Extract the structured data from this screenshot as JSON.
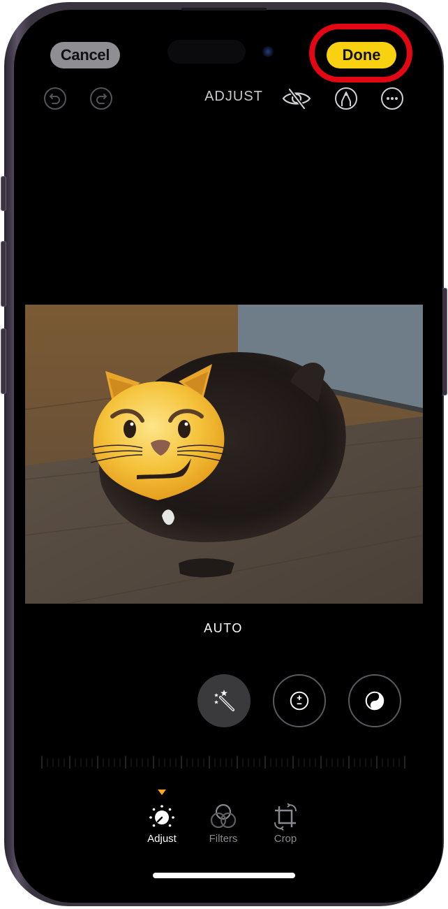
{
  "header": {
    "cancel_label": "Cancel",
    "done_label": "Done",
    "mode_title": "ADJUST",
    "highlight": {
      "target": "done-button",
      "color": "#e30613"
    }
  },
  "toolbar_icons": [
    "undo-icon",
    "redo-icon",
    "hide-markup-eye-slash-icon",
    "markup-pen-icon",
    "more-ellipsis-icon"
  ],
  "photo": {
    "description": "Black long-haired cat lying on wood floor next to gray wall, face covered by smirking cat emoji"
  },
  "adjust_tools": {
    "selected_label": "AUTO",
    "tools": [
      {
        "name": "Auto",
        "icon": "magic-wand-icon",
        "selected": true
      },
      {
        "name": "Exposure",
        "icon": "plus-minus-icon",
        "selected": false
      },
      {
        "name": "Brilliance",
        "icon": "yin-yang-icon",
        "selected": false
      }
    ]
  },
  "bottom_tabs": [
    {
      "label": "Adjust",
      "icon": "adjust-dial-icon",
      "active": true
    },
    {
      "label": "Filters",
      "icon": "filters-circles-icon",
      "active": false
    },
    {
      "label": "Crop",
      "icon": "crop-rotate-icon",
      "active": false
    }
  ],
  "colors": {
    "done_yellow": "#f8d211",
    "cancel_gray": "#8e8e93",
    "active_indicator": "#f5a623"
  }
}
